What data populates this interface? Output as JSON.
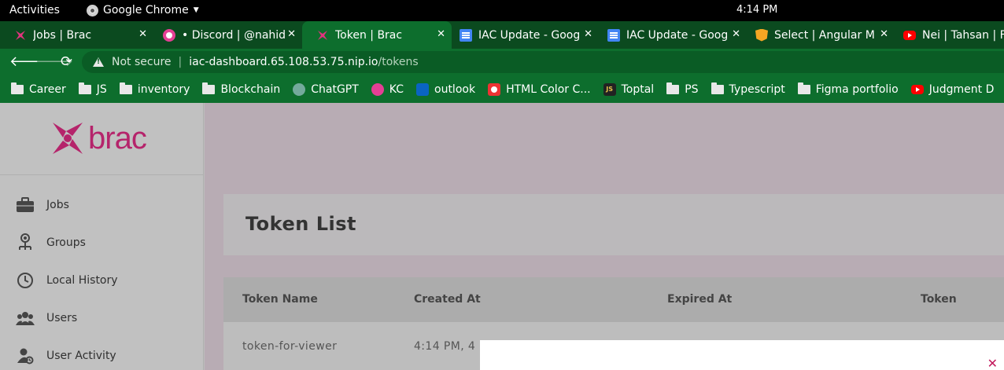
{
  "system": {
    "activities": "Activities",
    "app_name": "Google Chrome",
    "clock": "4:14 PM"
  },
  "tabs": [
    {
      "title": "Jobs | Brac",
      "favicon": "brac-icon"
    },
    {
      "title": "• Discord | @nahid",
      "favicon": "discord-icon"
    },
    {
      "title": "Token | Brac",
      "favicon": "brac-icon",
      "active": true
    },
    {
      "title": "IAC Update - Goog",
      "favicon": "google-docs-icon"
    },
    {
      "title": "IAC Update - Goog",
      "favicon": "google-docs-icon"
    },
    {
      "title": "Select | Angular M",
      "favicon": "angular-icon"
    },
    {
      "title": "Nei | Tahsan | F",
      "favicon": "youtube-icon"
    }
  ],
  "address_bar": {
    "security_label": "Not secure",
    "url_host": "iac-dashboard.65.108.53.75.nip.io",
    "url_path": "/tokens"
  },
  "bookmarks": [
    {
      "label": "Career",
      "icon": "folder-icon"
    },
    {
      "label": "JS",
      "icon": "folder-icon"
    },
    {
      "label": "inventory",
      "icon": "folder-icon"
    },
    {
      "label": "Blockchain",
      "icon": "folder-icon"
    },
    {
      "label": "ChatGPT",
      "icon": "chatgpt-icon"
    },
    {
      "label": "KC",
      "icon": "kc-icon"
    },
    {
      "label": "outlook",
      "icon": "outlook-icon"
    },
    {
      "label": "HTML Color C...",
      "icon": "html-color-icon"
    },
    {
      "label": "Toptal",
      "icon": "toptal-icon"
    },
    {
      "label": "PS",
      "icon": "folder-icon"
    },
    {
      "label": "Typescript",
      "icon": "folder-icon"
    },
    {
      "label": "Figma portfolio",
      "icon": "folder-icon"
    },
    {
      "label": "Judgment D",
      "icon": "youtube-icon"
    }
  ],
  "app": {
    "logo_text": "brac",
    "brand_color": "#b5246b",
    "sidebar": [
      {
        "label": "Jobs",
        "icon": "briefcase-icon"
      },
      {
        "label": "Groups",
        "icon": "groups-icon"
      },
      {
        "label": "Local History",
        "icon": "history-icon"
      },
      {
        "label": "Users",
        "icon": "users-icon"
      },
      {
        "label": "User Activity",
        "icon": "user-activity-icon"
      }
    ],
    "page_title": "Token List",
    "table": {
      "columns": [
        "Token Name",
        "Created At",
        "Expired At",
        "Token"
      ],
      "rows": [
        {
          "name": "token-for-viewer",
          "created_at": "4:14 PM, 4"
        }
      ]
    },
    "modal": {
      "close_icon": "close-icon"
    }
  }
}
